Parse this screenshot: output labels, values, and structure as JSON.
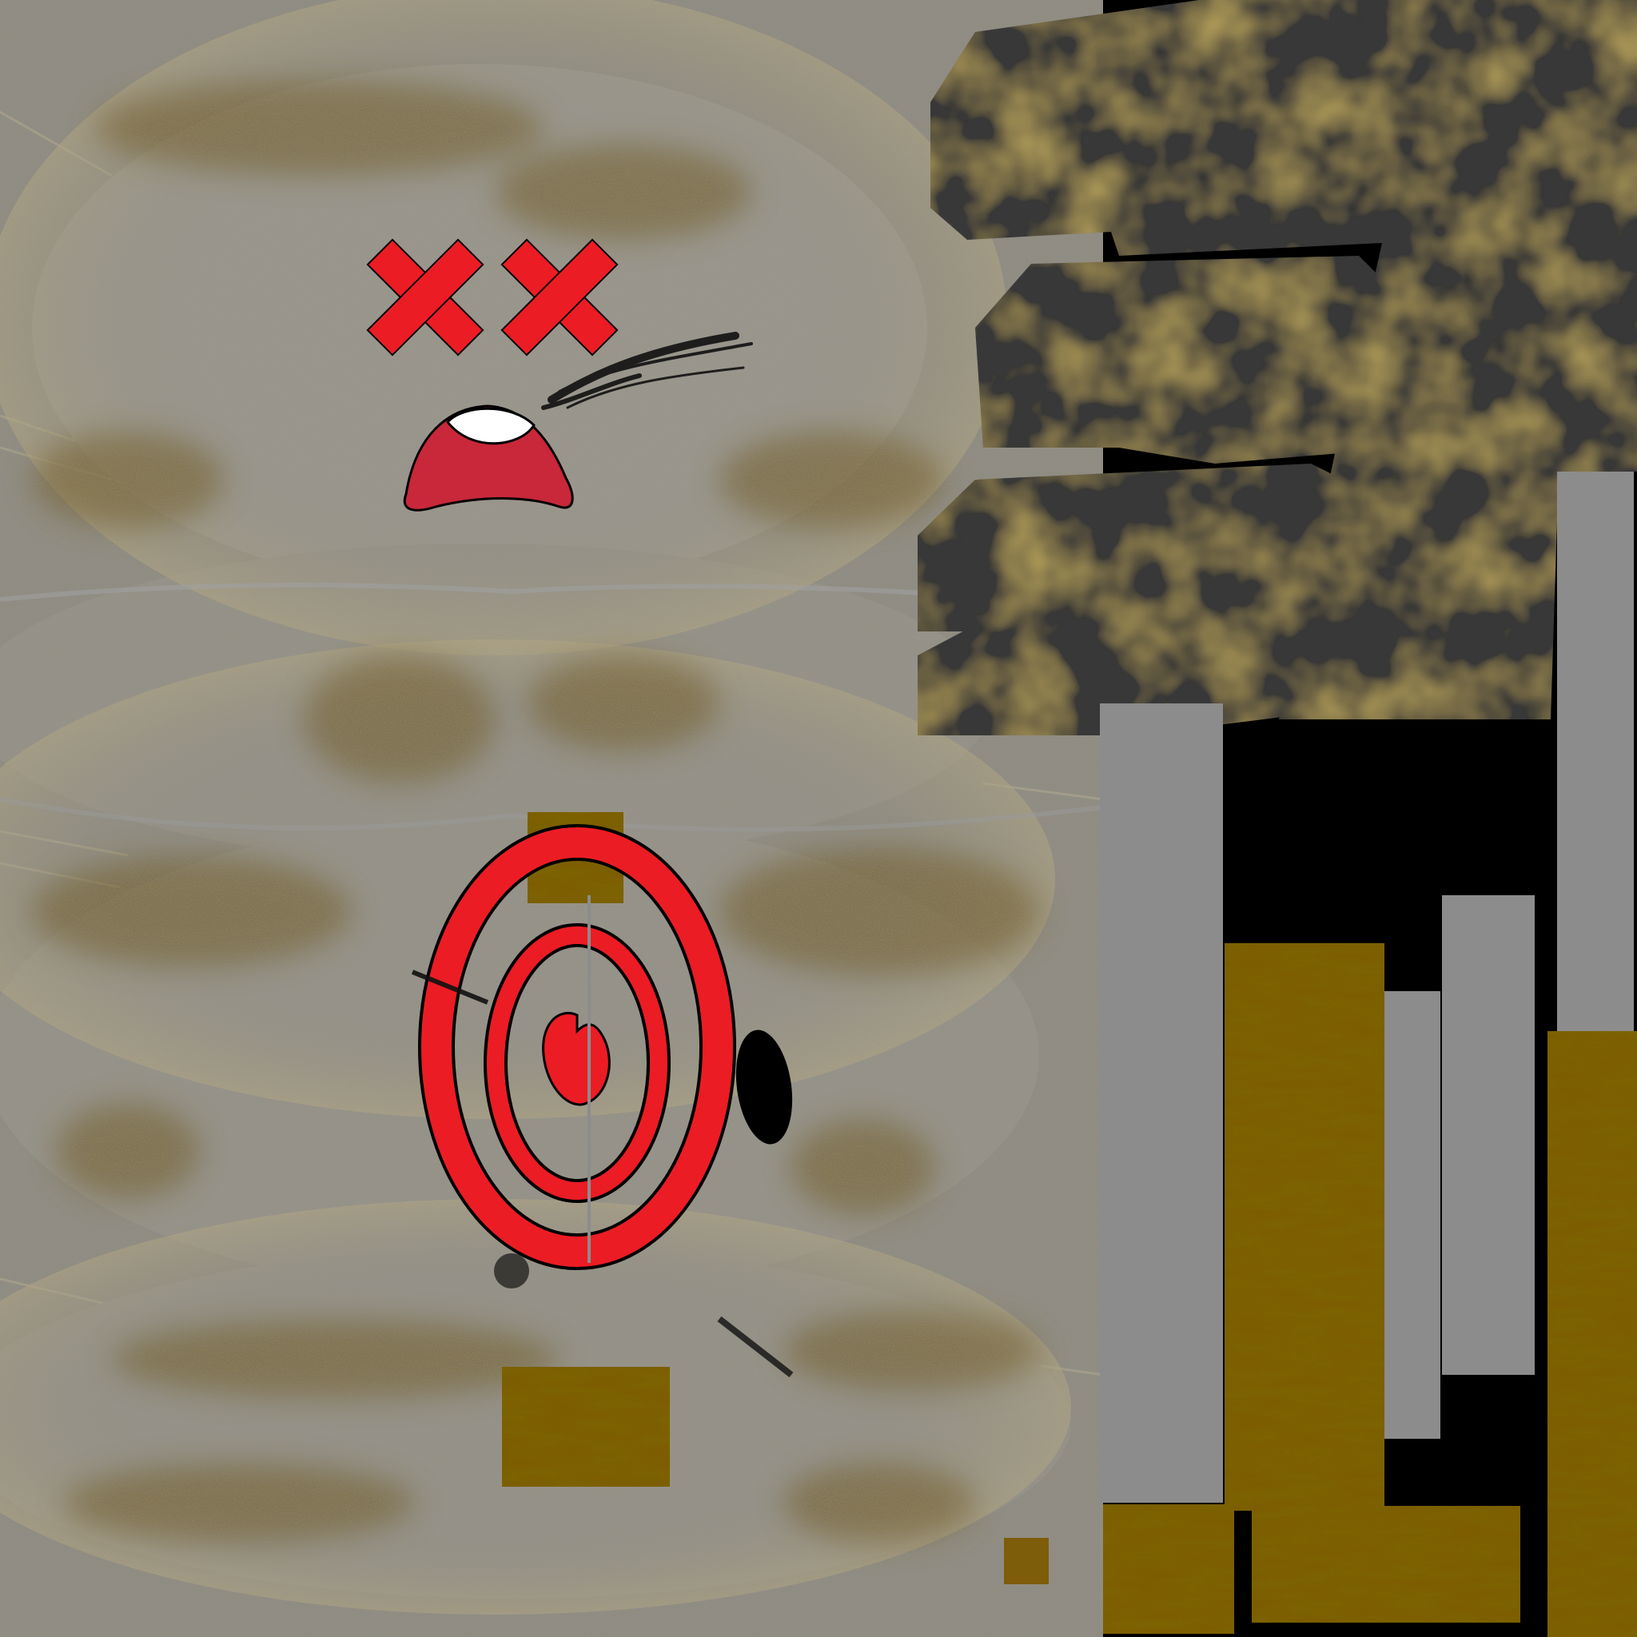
{
  "palette": {
    "background": "#000000",
    "fur_gray": "#8c8c8c",
    "fur_gray_light": "#969696",
    "dirt_brown": "#7a5a14",
    "dark_patch": "#383838",
    "ochre": "#7d5c0a",
    "red": "#ec1c24",
    "mouth_red": "#c8283a",
    "tooth_white": "#ffffff",
    "outline": "#000000",
    "ink": "#111111"
  },
  "texture": {
    "kind": "uv texture atlas",
    "regions": [
      "gray-fur-body",
      "face-dead-expression",
      "target-spiral",
      "dark-dirty-patches",
      "gray-strips",
      "ochre-strips"
    ]
  }
}
